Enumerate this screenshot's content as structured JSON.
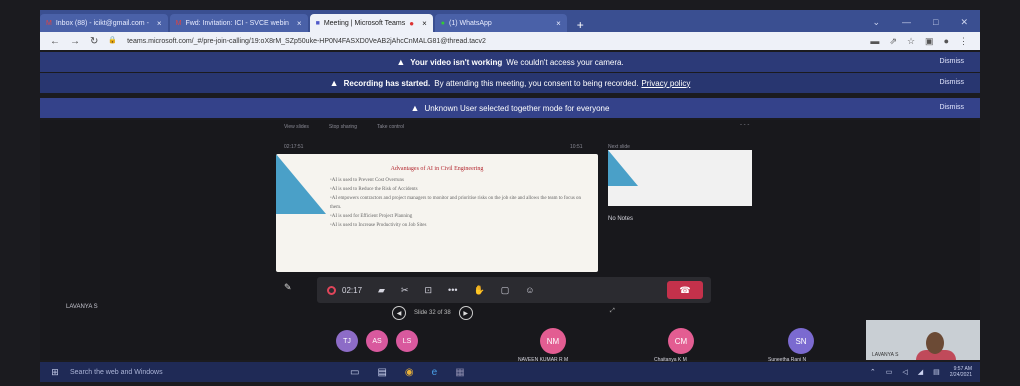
{
  "browser": {
    "tabs": [
      {
        "label": "Inbox (88) - icikt@gmail.com -",
        "icon": "gmail-icon",
        "active": false
      },
      {
        "label": "Fwd: Invitation: ICI - SVCE webin",
        "icon": "gmail-icon",
        "active": false
      },
      {
        "label": "Meeting | Microsoft Teams",
        "icon": "teams-icon",
        "active": true
      },
      {
        "label": "(1) WhatsApp",
        "icon": "whatsapp-icon",
        "active": false
      }
    ],
    "url": "teams.microsoft.com/_#/pre-join-calling/19:oX8rM_SZp50uke-HP0N4FASXD0VeAB2jAhcCnMALG81@thread.tacv2"
  },
  "banners": [
    {
      "bold": "Your video isn't working",
      "text": "We couldn't access your camera.",
      "link": "",
      "dismiss": "Dismiss"
    },
    {
      "bold": "Recording has started.",
      "text": "By attending this meeting, you consent to being recorded.",
      "link": "Privacy policy",
      "dismiss": "Dismiss"
    },
    {
      "bold": "",
      "text": "Unknown User selected together mode for everyone",
      "link": "",
      "dismiss": "Dismiss"
    }
  ],
  "meeting": {
    "toolbar_small": [
      "View slides",
      "Stop sharing",
      "Take control"
    ],
    "slide_header": "02:17:51",
    "slide_right_header": "10:51",
    "next_label": "Next slide",
    "slide": {
      "title": "Advantages of AI in Civil Engineering",
      "bullets": [
        "AI is used to Prevent Cost Overruns",
        "AI is used to Reduce the Risk of Accidents",
        "AI empowers contractors and project managers to monitor and prioritise risks on the job site and allows the team to focus on them.",
        "AI is used for Efficient Project Planning",
        "AI is used to Increase Productivity on Job Sites"
      ]
    },
    "notes": "No Notes",
    "timer": "02:17",
    "slide_counter": "Slide 32 of 38",
    "presenter": "LAVANYA S",
    "participants_small": [
      "TJ",
      "AS",
      "LS"
    ],
    "tiles": [
      {
        "initials": "NM",
        "name": "NAVEEN KUMAR R M"
      },
      {
        "initials": "CM",
        "name": "Chaitanya K M"
      },
      {
        "initials": "SN",
        "name": "Suneetha Rani N"
      }
    ],
    "self_name": "LAVANYA S"
  },
  "taskbar": {
    "search": "Search the web and Windows",
    "time": "9:57 AM",
    "date": "2/24/2021"
  }
}
